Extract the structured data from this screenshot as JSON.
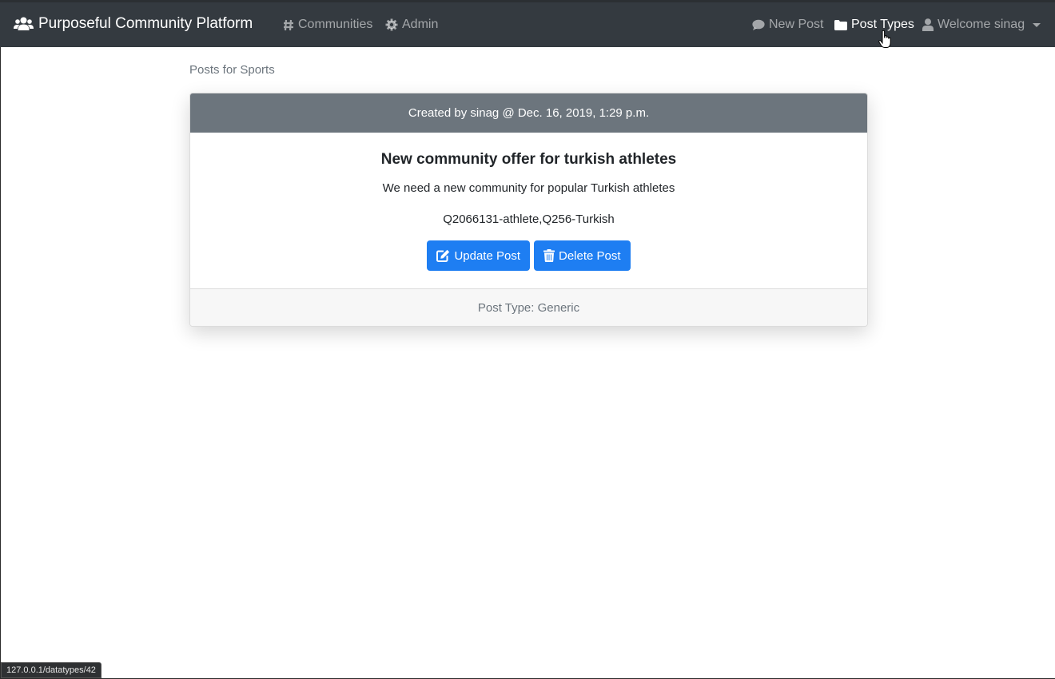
{
  "navbar": {
    "brand": {
      "label": "Purposeful Community Platform",
      "icon": "users-icon"
    },
    "left_links": [
      {
        "label": "Communities",
        "icon": "hashtag-icon"
      },
      {
        "label": "Admin",
        "icon": "gear-icon"
      }
    ],
    "right_links": [
      {
        "label": "New Post",
        "icon": "comment-icon"
      },
      {
        "label": "Post Types",
        "icon": "folder-icon"
      },
      {
        "label": "Welcome sinag",
        "icon": "user-icon"
      }
    ]
  },
  "page": {
    "subtitle": "Posts for Sports"
  },
  "post": {
    "header": "Created by sinag @ Dec. 16, 2019, 1:29 p.m.",
    "title": "New community offer for turkish athletes",
    "description": "We need a new community for popular Turkish athletes",
    "tags": "Q2066131-athlete,Q256-Turkish",
    "update_label": "Update Post",
    "delete_label": "Delete Post",
    "footer": "Post Type: Generic"
  },
  "status_bar": {
    "url": "127.0.0.1/datatypes/42"
  },
  "colors": {
    "navbar": "#343a40",
    "card_header": "#6c757d",
    "primary_button": "#1e7ef2"
  }
}
